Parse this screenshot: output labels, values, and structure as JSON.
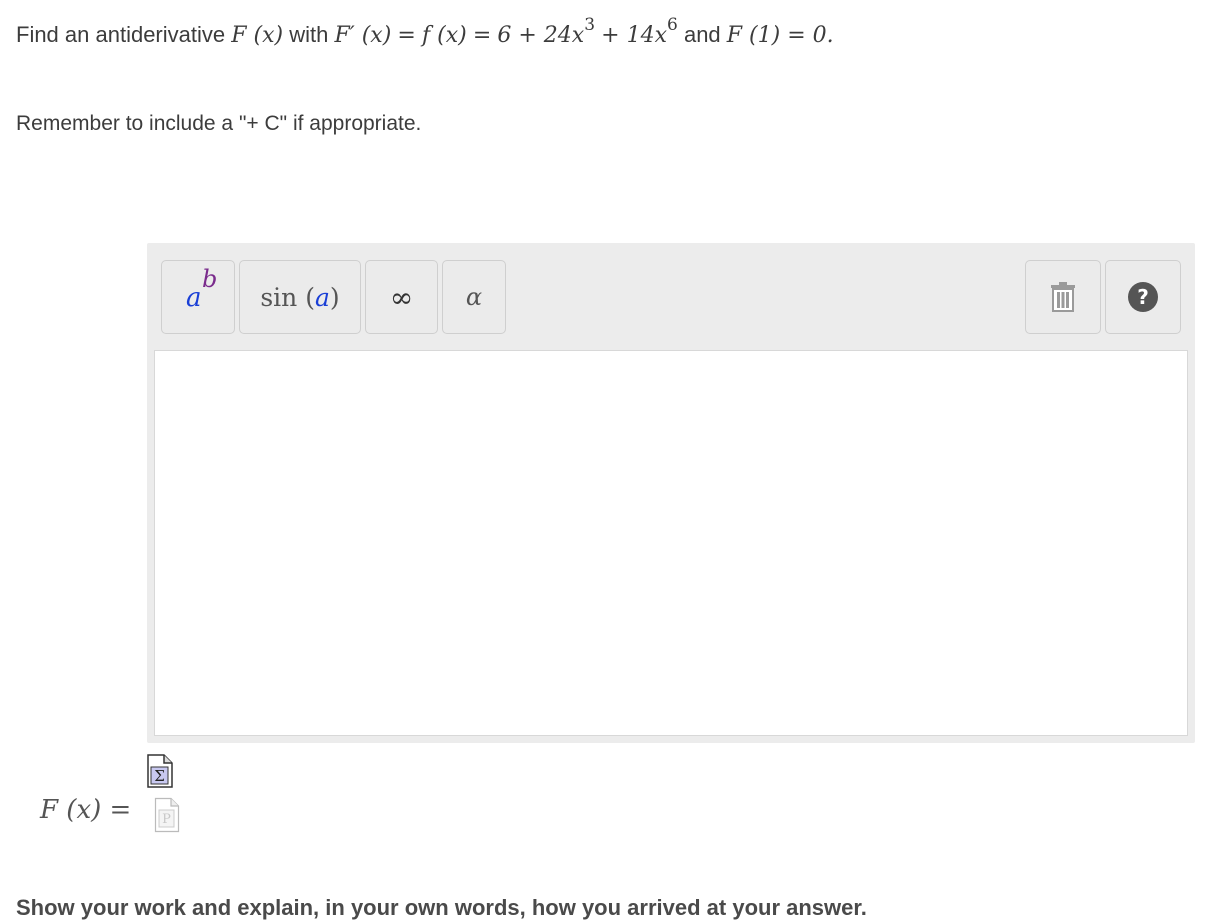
{
  "question": {
    "prefix": "Find an antiderivative",
    "F_of_x": "F (x)",
    "with": "with",
    "derivative_lhs": "F′ (x)",
    "eq1": "=",
    "f_of_x": "f (x)",
    "eq2": "=",
    "term_const": "6 + 24x",
    "exp1": "3",
    "plus_term": "+ 14x",
    "exp2": "6",
    "and": "and",
    "condition": "F (1) = 0."
  },
  "reminder": "Remember to include a \"+ C\" if appropriate.",
  "toolbar": {
    "power_base": "a",
    "power_exp": "b",
    "sin_fn": "sin",
    "sin_open": " (",
    "sin_arg": "a",
    "sin_close": ")",
    "infinity": "∞",
    "alpha": "α",
    "icons": {
      "trash": "trash-icon",
      "help": "help-icon"
    }
  },
  "answer_label": "F (x) =",
  "work_prompt": "Show your work and explain, in your own words, how you arrived at your answer.",
  "colors": {
    "editor_bg": "#ececec",
    "accent_blue": "#1a3fd6",
    "accent_purple": "#7a2b8c"
  }
}
